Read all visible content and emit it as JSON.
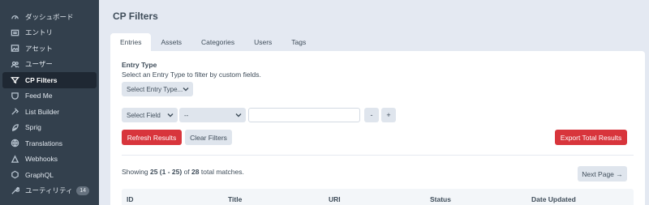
{
  "sidebar": {
    "items": [
      {
        "label": "ダッシュボード",
        "icon": "gauge-icon"
      },
      {
        "label": "エントリ",
        "icon": "newspaper-icon"
      },
      {
        "label": "アセット",
        "icon": "image-icon"
      },
      {
        "label": "ユーザー",
        "icon": "users-icon"
      },
      {
        "label": "CP Filters",
        "icon": "filter-plugin-icon",
        "active": true
      },
      {
        "label": "Feed Me",
        "icon": "feed-me-icon"
      },
      {
        "label": "List Builder",
        "icon": "list-builder-icon"
      },
      {
        "label": "Sprig",
        "icon": "sprig-icon"
      },
      {
        "label": "Translations",
        "icon": "translations-icon"
      },
      {
        "label": "Webhooks",
        "icon": "webhooks-icon"
      },
      {
        "label": "GraphQL",
        "icon": "graphql-icon"
      },
      {
        "label": "ユーティリティ",
        "icon": "wrench-icon",
        "badge": "14"
      }
    ]
  },
  "header": {
    "title": "CP Filters"
  },
  "tabs": [
    "Entries",
    "Assets",
    "Categories",
    "Users",
    "Tags"
  ],
  "filters": {
    "entry_type_label": "Entry Type",
    "entry_type_help": "Select an Entry Type to filter by custom fields.",
    "entry_type_select": "Select Entry Type...",
    "field_select": "Select Field",
    "operator_select": "--",
    "value_input": "",
    "remove_label": "-",
    "add_label": "+",
    "refresh_label": "Refresh Results",
    "clear_label": "Clear Filters",
    "export_label": "Export Total Results"
  },
  "results": {
    "showing_prefix": "Showing",
    "showing_count": "25 (1 - 25)",
    "showing_of": "of",
    "total": "28",
    "showing_suffix": "total matches.",
    "next_label": "Next Page →",
    "columns": [
      "ID",
      "Title",
      "URI",
      "Status",
      "Date Updated"
    ]
  },
  "colors": {
    "sidebar": "#33404d",
    "accent": "#d8353c",
    "background": "#e4e9f2"
  }
}
